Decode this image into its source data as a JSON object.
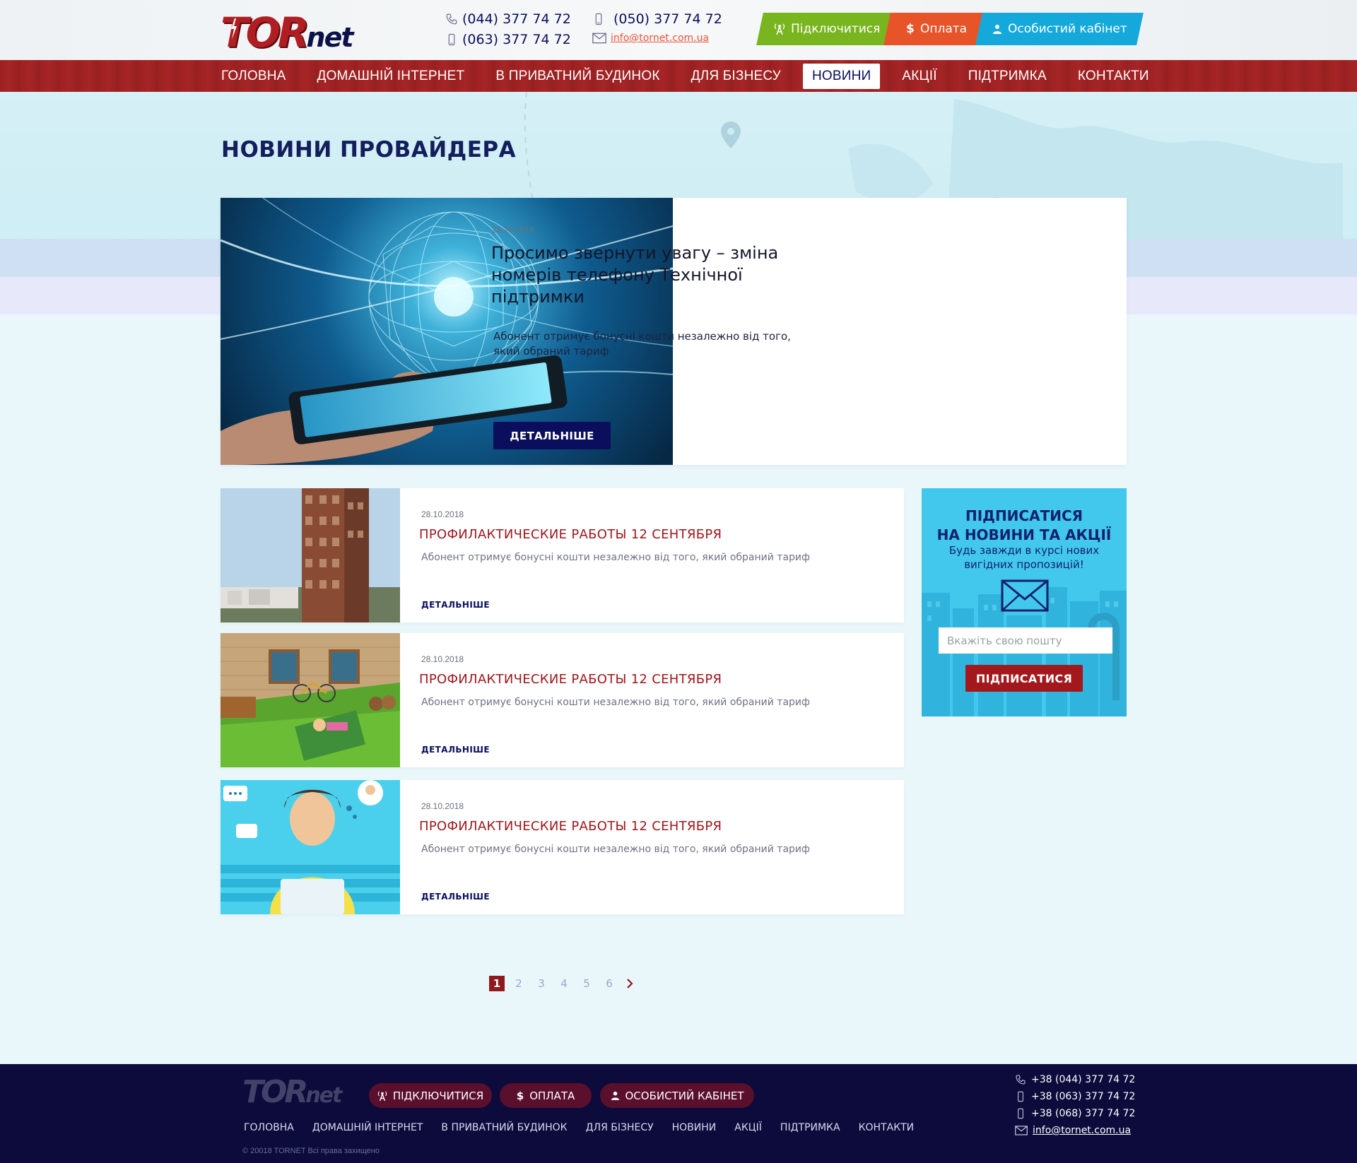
{
  "header": {
    "logo": {
      "tor": "TOR",
      "net": "net"
    },
    "phones": [
      "(044) 377 74 72",
      "(063) 377 74 72",
      "(050) 377 74 72"
    ],
    "email": "info@tornet.com.ua",
    "buttons": {
      "connect": "Підключитися",
      "payment": "Оплата",
      "cabinet": "Особистий кабінет"
    }
  },
  "nav": {
    "items": [
      "ГОЛОВНА",
      "ДОМАШНІЙ ІНТЕРНЕТ",
      "В ПРИВАТНИЙ БУДИНОК",
      "ДЛЯ БІЗНЕСУ",
      "НОВИНИ",
      "АКЦІЇ",
      "ПІДТРИМКА",
      "КОНТАКТИ"
    ],
    "active": "НОВИНИ"
  },
  "page": {
    "title": "НОВИНИ ПРОВАЙДЕРА"
  },
  "featured": {
    "date": "28.10.2018",
    "title": "Просимо звернути  увагу – зміна номерів телефону Технічної підтримки",
    "excerpt": "Абонент отримує бонусні  кошти незалежно від того, який обраний тариф",
    "button": "ДЕТАЛЬНІШЕ"
  },
  "news": [
    {
      "date": "28.10.2018",
      "title": "ПРОФИЛАКТИЧЕСКИЕ  РАБОТЫ 12 СЕНТЯБРЯ",
      "excerpt": "Абонент отримує бонусні  кошти незалежно від того,  який обраний тариф",
      "more": "ДЕТАЛЬНІШЕ"
    },
    {
      "date": "28.10.2018",
      "title": "ПРОФИЛАКТИЧЕСКИЕ  РАБОТЫ 12 СЕНТЯБРЯ",
      "excerpt": "Абонент отримує бонусні  кошти незалежно від того,  який обраний тариф",
      "more": "ДЕТАЛЬНІШЕ"
    },
    {
      "date": "28.10.2018",
      "title": "ПРОФИЛАКТИЧЕСКИЕ  РАБОТЫ 12 СЕНТЯБРЯ",
      "excerpt": "Абонент отримує бонусні  кошти незалежно від того,  який обраний тариф",
      "more": "ДЕТАЛЬНІШЕ"
    }
  ],
  "subscribe": {
    "title_line1": "ПІДПИСАТИСЯ",
    "title_line2": "НА НОВИНИ ТА АКЦІЇ",
    "text_line1": "Будь завжди в курсі нових",
    "text_line2": "вигідних пропозицій!",
    "placeholder": "Вкажіть свою пошту",
    "button": "ПІДПИСАТИСЯ"
  },
  "pagination": {
    "pages": [
      "1",
      "2",
      "3",
      "4",
      "5",
      "6"
    ],
    "current": "1"
  },
  "footer": {
    "buttons": {
      "connect": "ПІДКЛЮЧИТИСЯ",
      "payment": "ОПЛАТА",
      "cabinet": "ОСОБИСТИЙ КАБІНЕТ"
    },
    "nav": [
      "ГОЛОВНА",
      "ДОМАШНІЙ ІНТЕРНЕТ",
      "В ПРИВАТНИЙ БУДИНОК",
      "ДЛЯ БІЗНЕСУ",
      "НОВИНИ",
      "АКЦІЇ",
      "ПІДТРИМКА",
      "КОНТАКТИ"
    ],
    "copyright": "© 20018 TORNET Всі права захищено",
    "phones": [
      "+38 (044) 377 74 72",
      "+38 (063) 377 74 72",
      "+38 (068) 377 74 72"
    ],
    "email": "info@tornet.com.ua"
  },
  "colors": {
    "brand_red": "#a3181c",
    "navy": "#0a0e5c",
    "green": "#79b51f",
    "orange": "#e8542a",
    "blue": "#14a9da",
    "footer_bg": "#0c0b3c"
  }
}
